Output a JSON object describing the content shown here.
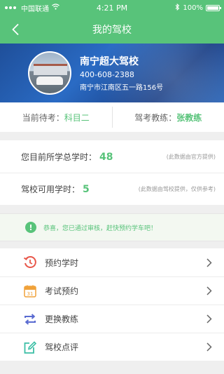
{
  "status_bar": {
    "carrier": "中国联通",
    "time": "4:21 PM",
    "battery": "100%"
  },
  "nav": {
    "title": "我的驾校"
  },
  "school": {
    "name": "南宁超大驾校",
    "phone": "400-608-2388",
    "address": "南宁市江南区五一路156号"
  },
  "exam": {
    "current_label": "当前待考：",
    "current_value": "科目二",
    "coach_label": "驾考教练：",
    "coach_value": "张教练"
  },
  "hours": {
    "total_label": "您目前所学总学时：",
    "total_value": "48",
    "total_note": "(此数据由官方提供)",
    "available_label": "驾校可用学时：",
    "available_value": "5",
    "available_note": "(此数据由驾校提供，仅供参考)"
  },
  "notice": {
    "text": "恭喜，您已通过审核，赶快预约学车吧！"
  },
  "menu": [
    {
      "label": "预约学时",
      "icon": "clock-icon"
    },
    {
      "label": "考试预约",
      "icon": "calendar-icon"
    },
    {
      "label": "更换教练",
      "icon": "swap-icon"
    },
    {
      "label": "驾校点评",
      "icon": "review-icon"
    }
  ],
  "calendar_day": "31",
  "colors": {
    "primary": "#58c37a",
    "banner": "#2a6bc4"
  }
}
